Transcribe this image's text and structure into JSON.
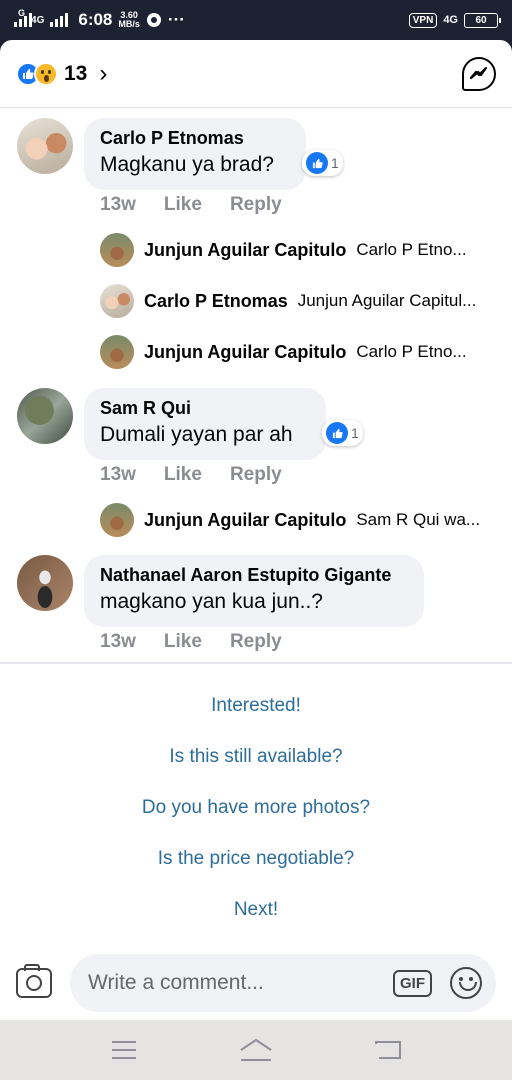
{
  "status_bar": {
    "carrier_label": "G",
    "network_label": "4G",
    "time": "6:08",
    "speed_value": "3.60",
    "speed_unit": "MB/s",
    "more": "···",
    "vpn_label": "VPN",
    "network_label_2": "4G",
    "battery": "60"
  },
  "header": {
    "reaction_count": "13",
    "reaction_icons": [
      "like-icon",
      "wow-icon"
    ],
    "chevron": "›"
  },
  "comments": [
    {
      "name": "Carlo P Etnomas",
      "text": "Magkanu ya brad?",
      "time": "13w",
      "like_label": "Like",
      "reply_label": "Reply",
      "reaction_count": "1",
      "replies": [
        {
          "name": "Junjun Aguilar Capitulo",
          "preview": "Carlo P Etno..."
        },
        {
          "name": "Carlo P Etnomas",
          "preview": "Junjun Aguilar Capitul..."
        },
        {
          "name": "Junjun Aguilar Capitulo",
          "preview": "Carlo P Etno..."
        }
      ]
    },
    {
      "name": "Sam R Qui",
      "text": "Dumali yayan par ah",
      "time": "13w",
      "like_label": "Like",
      "reply_label": "Reply",
      "reaction_count": "1",
      "replies": [
        {
          "name": "Junjun Aguilar Capitulo",
          "preview": "Sam R Qui wa..."
        }
      ]
    },
    {
      "name": "Nathanael Aaron Estupito Gigante",
      "text": "magkano yan kua jun..?",
      "time": "13w",
      "like_label": "Like",
      "reply_label": "Reply"
    }
  ],
  "suggestions": [
    "Interested!",
    "Is this still available?",
    "Do you have more photos?",
    "Is the price negotiable?",
    "Next!"
  ],
  "composer": {
    "placeholder": "Write a comment...",
    "gif_label": "GIF"
  },
  "colors": {
    "accent": "#1877f2",
    "suggestion_text": "#2d6d99",
    "bubble_bg": "#f0f2f5",
    "meta_text": "#8a8d91"
  }
}
